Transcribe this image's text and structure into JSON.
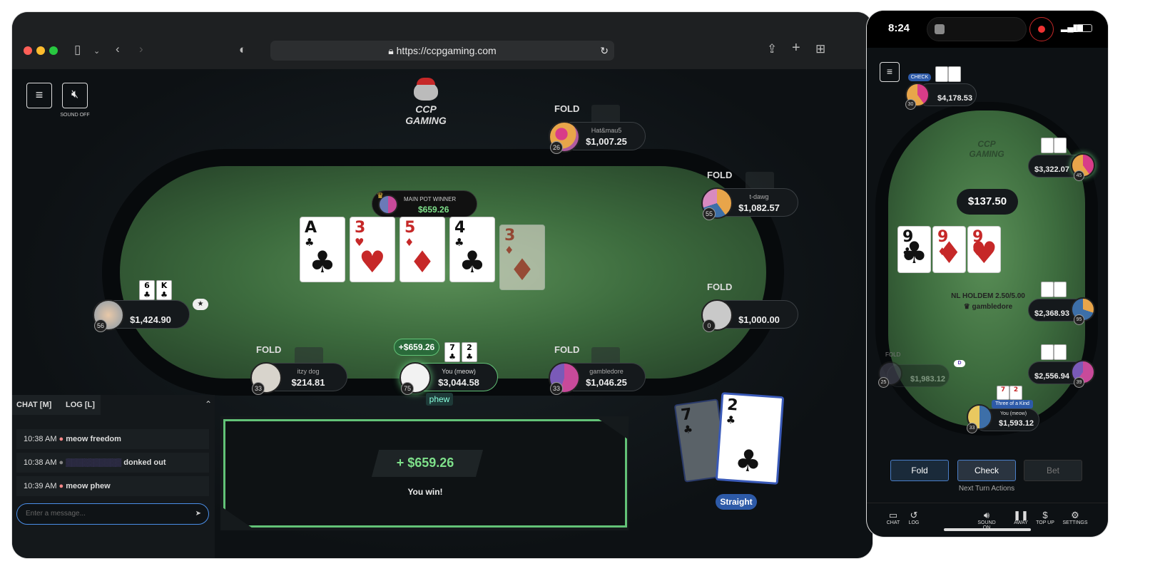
{
  "browser": {
    "url": "https://ccpgaming.com"
  },
  "game": {
    "menu_icon": "hamburger-icon",
    "sound_label": "SOUND OFF",
    "logo_text": "CCP GAMING",
    "main_pot": {
      "label": "MAIN POT WINNER",
      "amount": "$659.26"
    },
    "board": [
      {
        "rank": "A",
        "suit": "♣",
        "color": "black"
      },
      {
        "rank": "3",
        "suit": "♥",
        "color": "red"
      },
      {
        "rank": "5",
        "suit": "♦",
        "color": "red"
      },
      {
        "rank": "4",
        "suit": "♣",
        "color": "black"
      },
      {
        "rank": "3",
        "suit": "♦",
        "color": "red"
      }
    ],
    "seats": {
      "hatmau": {
        "name": "Hat&mau5",
        "stack": "$1,007.25",
        "level": "26",
        "status": "FOLD"
      },
      "tdawg": {
        "name": "t-dawg",
        "stack": "$1,082.57",
        "level": "55",
        "status": "FOLD"
      },
      "empty_right": {
        "name": "",
        "stack": "$1,000.00",
        "level": "0",
        "status": "FOLD"
      },
      "gambledore": {
        "name": "gambledore",
        "stack": "$1,046.25",
        "level": "33",
        "status": "FOLD"
      },
      "you": {
        "name": "You (meow)",
        "stack": "$3,044.58",
        "level": "75",
        "win_chip": "+$659.26",
        "chat_bubble": "phew",
        "cards": [
          "7♣",
          "2♣"
        ]
      },
      "itzy": {
        "name": "itzy dog",
        "stack": "$214.81",
        "level": "33",
        "status": "FOLD"
      },
      "left": {
        "name": "",
        "stack": "$1,424.90",
        "level": "56",
        "cards": [
          "6♣",
          "K♣"
        ]
      }
    },
    "chat": {
      "tab_chat": "CHAT [M]",
      "tab_log": "LOG [L]",
      "messages": [
        {
          "time": "10:38 AM",
          "user": "meow",
          "text": "freedom"
        },
        {
          "time": "10:38 AM",
          "user": "",
          "text": "donked out"
        },
        {
          "time": "10:39 AM",
          "user": "meow",
          "text": "phew"
        }
      ],
      "placeholder": "Enter a message..."
    },
    "win": {
      "amount": "+ $659.26",
      "text": "You win!"
    },
    "hand": {
      "cards": [
        {
          "rank": "7",
          "suit": "♣"
        },
        {
          "rank": "2",
          "suit": "♣"
        }
      ],
      "label": "Straight"
    }
  },
  "phone": {
    "time": "8:24",
    "pot": "$137.50",
    "board": [
      {
        "rank": "9",
        "suit": "♣",
        "color": "black"
      },
      {
        "rank": "9",
        "suit": "♦",
        "color": "red"
      },
      {
        "rank": "9",
        "suit": "♥",
        "color": "red"
      }
    ],
    "table_name": "NL HOLDEM 2.50/5.00",
    "host": "gambledore",
    "seats": [
      {
        "stack": "$4,178.53",
        "level": "30",
        "badge": "CHECK"
      },
      {
        "stack": "$3,322.07",
        "level": "45"
      },
      {
        "stack": "$2,368.93",
        "level": "95"
      },
      {
        "stack": "$2,556.94",
        "level": "39"
      },
      {
        "stack": "$1,983.12",
        "level": "25",
        "status": "FOLD"
      },
      {
        "name": "You (meow)",
        "stack": "$1,593.12",
        "level": "33",
        "hand_label": "Three of a Kind"
      }
    ],
    "actions": {
      "fold": "Fold",
      "check": "Check",
      "bet": "Bet",
      "next": "Next Turn Actions"
    },
    "nav": {
      "chat": "CHAT",
      "log": "LOG",
      "sound": "SOUND ON",
      "away": "AWAY",
      "topup": "TOP UP",
      "settings": "SETTINGS"
    }
  }
}
